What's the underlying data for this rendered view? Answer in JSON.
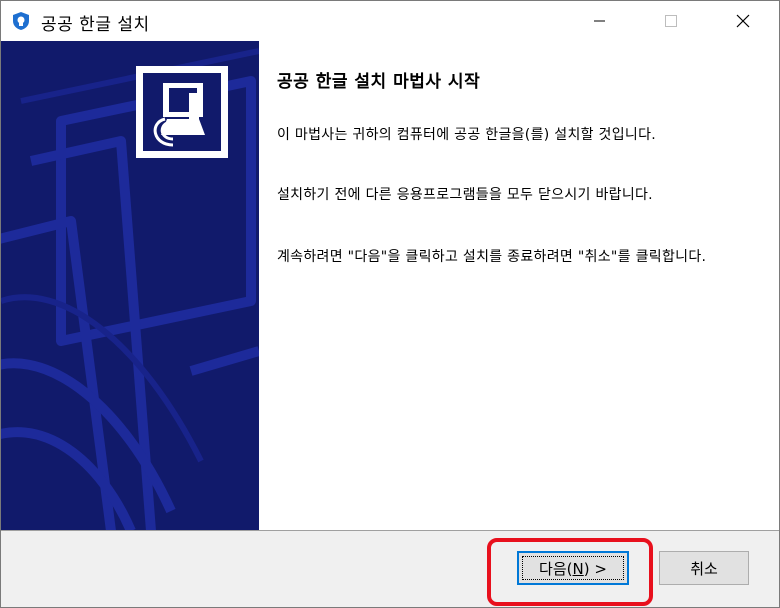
{
  "window": {
    "title": "공공 한글 설치",
    "accent_color": "#111a6b",
    "highlight_color": "#e8101d",
    "controls": {
      "minimize": "minimize-icon",
      "maximize": "maximize-icon",
      "close": "close-icon"
    }
  },
  "wizard": {
    "heading": "공공 한글 설치 마법사 시작",
    "paragraphs": [
      "이 마법사는 귀하의 컴퓨터에 공공 한글을(를) 설치할 것입니다.",
      "설치하기 전에 다른 응용프로그램들을 모두 닫으시기 바랍니다.",
      "계속하려면 \"다음\"을 클릭하고 설치를 종료하려면 \"취소\"를 클릭합니다."
    ]
  },
  "buttons": {
    "next": {
      "prefix": "다음(",
      "mnemonic": "N",
      "suffix": ") >"
    },
    "cancel": "취소"
  }
}
